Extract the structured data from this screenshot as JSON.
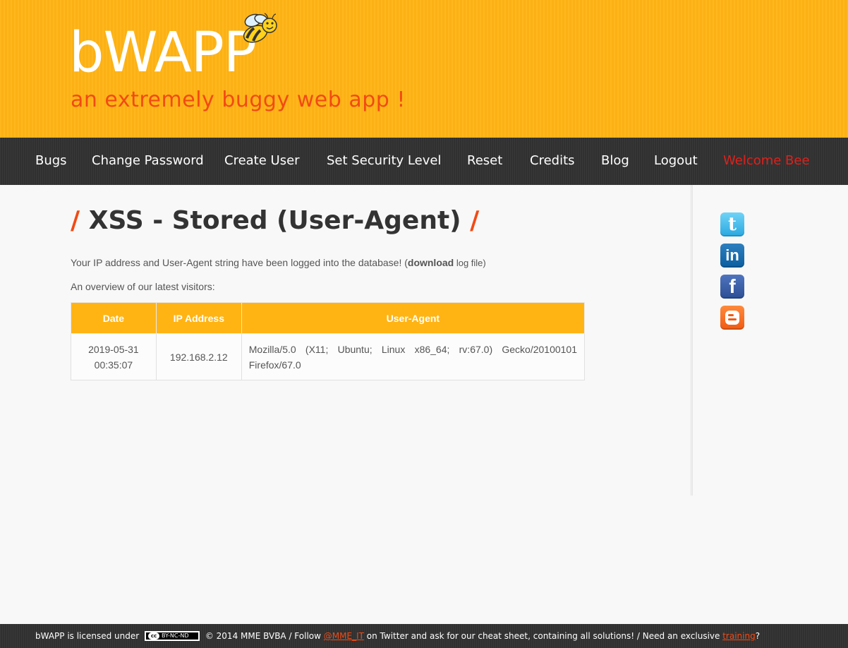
{
  "header": {
    "logo": "bWAPP",
    "tagline": "an extremely buggy web app !"
  },
  "nav": {
    "items": [
      "Bugs",
      "Change Password",
      "Create User",
      "Set Security Level",
      "Reset",
      "Credits",
      "Blog",
      "Logout"
    ],
    "welcome": "Welcome Bee"
  },
  "main": {
    "title_slash": "/",
    "title": "XSS - Stored (User-Agent)",
    "intro_text": "Your IP address and User-Agent string have been logged into the database! (",
    "download_bold": "download",
    "download_rest": " log file",
    "intro_close": ")",
    "overview": "An overview of our latest visitors:",
    "table": {
      "headers": [
        "Date",
        "IP Address",
        "User-Agent"
      ],
      "rows": [
        {
          "date_day": "2019-05-31",
          "date_time": "00:35:07",
          "ip": "192.168.2.12",
          "user_agent": "Mozilla/5.0 (X11; Ubuntu; Linux x86_64; rv:67.0) Gecko/20100101 Firefox/67.0"
        }
      ]
    }
  },
  "social": {
    "twitter_glyph": "t",
    "linkedin_glyph": "in",
    "facebook_glyph": "f"
  },
  "footer": {
    "text_1": "bWAPP is licensed under",
    "cc_badge_cc": "cc",
    "cc_badge_text": "BY-NC-ND",
    "text_2": "© 2014 MME BVBA / Follow",
    "twitter_handle": "@MME_IT",
    "text_3": "on Twitter and ask for our cheat sheet, containing all solutions! / Need an exclusive",
    "training_link": "training",
    "text_4": "?"
  },
  "colors": {
    "accent_orange": "#ffb414",
    "accent_red": "#f24a14",
    "nav_dark": "#333333",
    "welcome_red": "#e0201a"
  }
}
